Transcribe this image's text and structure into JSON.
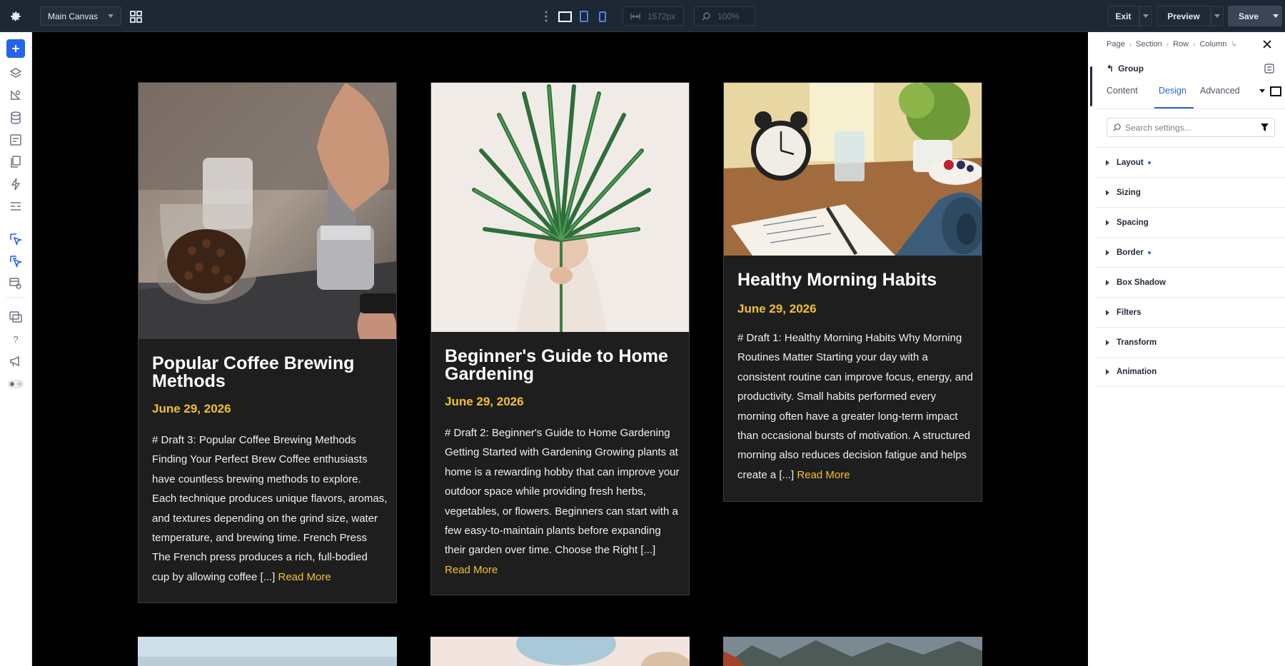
{
  "topbar": {
    "canvas_label": "Main Canvas",
    "width_value": "1572px",
    "zoom_value": "100%",
    "exit_label": "Exit",
    "preview_label": "Preview",
    "save_label": "Save"
  },
  "cards": [
    {
      "title": "Popular Coffee Brewing Methods",
      "date": "June 29, 2026",
      "excerpt": "# Draft 3: Popular Coffee Brewing Methods Finding Your Perfect Brew Coffee enthusiasts have countless brewing methods to explore. Each technique produces unique flavors, aromas, and textures depending on the grind size, water temperature, and brewing time. French Press The French press produces a rich, full-bodied cup by allowing coffee [...]",
      "read_more": "Read More"
    },
    {
      "title": "Beginner's Guide to Home Gardening",
      "date": "June 29, 2026",
      "excerpt": "# Draft 2: Beginner's Guide to Home Gardening Getting Started with Gardening Growing plants at home is a rewarding hobby that can improve your outdoor space while providing fresh herbs, vegetables, or flowers. Beginners can start with a few easy-to-maintain plants before expanding their garden over time. Choose the Right [...]",
      "read_more": "Read More"
    },
    {
      "title": "Healthy Morning Habits",
      "date": "June 29, 2026",
      "excerpt": "# Draft 1: Healthy Morning Habits Why Morning Routines Matter Starting your day with a consistent routine can improve focus, energy, and productivity. Small habits performed every morning often have a greater long-term impact than occasional bursts of motivation. A structured morning also reduces decision fatigue and helps create a [...]",
      "read_more": "Read More"
    }
  ],
  "panel": {
    "breadcrumb": [
      "Page",
      "Section",
      "Row",
      "Column"
    ],
    "group_label": "Group",
    "tabs": [
      "Content",
      "Design",
      "Advanced"
    ],
    "active_tab": "Design",
    "search_placeholder": "Search settings...",
    "sections": [
      {
        "label": "Layout",
        "modified": true
      },
      {
        "label": "Sizing",
        "modified": false
      },
      {
        "label": "Spacing",
        "modified": false
      },
      {
        "label": "Border",
        "modified": true
      },
      {
        "label": "Box Shadow",
        "modified": false
      },
      {
        "label": "Filters",
        "modified": false
      },
      {
        "label": "Transform",
        "modified": false
      },
      {
        "label": "Animation",
        "modified": false
      }
    ]
  },
  "colors": {
    "accent": "#2563eb",
    "date_yellow": "#f2c230",
    "card_bg": "#1e1e1e",
    "topbar_bg": "#1e2734"
  }
}
